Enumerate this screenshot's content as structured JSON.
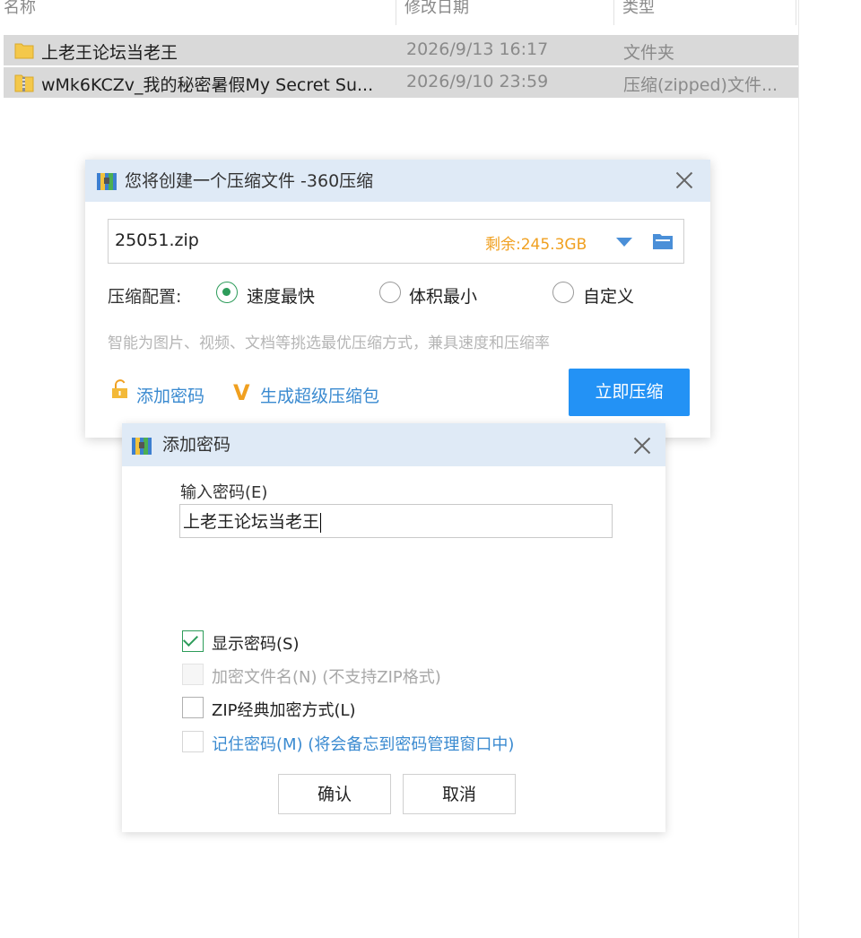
{
  "explorer": {
    "columns": [
      "名称",
      "修改日期",
      "类型"
    ],
    "rows": [
      {
        "name": "上老王论坛当老王",
        "date": "2026/9/13 16:17",
        "type": "文件夹"
      },
      {
        "name": "wMk6KCZv_我的秘密暑假My Secret Su...",
        "date": "2026/9/10 23:59",
        "type": "压缩(zipped)文件..."
      }
    ]
  },
  "compress_dialog": {
    "title": "您将创建一个压缩文件 -360压缩",
    "filename": "25051.zip",
    "remaining": "剩余:245.3GB",
    "config_label": "压缩配置:",
    "options": [
      "速度最快",
      "体积最小",
      "自定义"
    ],
    "selected_option": "速度最快",
    "hint": "智能为图片、视频、文档等挑选最优压缩方式，兼具速度和压缩率",
    "add_password": "添加密码",
    "super_pack": "生成超级压缩包",
    "compress_button": "立即压缩",
    "colors": {
      "accent": "#2392f5",
      "titlebar": "#dfeaf6",
      "orange": "#f0a020",
      "link": "#3a8ad0",
      "green": "#2d9c5a"
    }
  },
  "password_dialog": {
    "title": "添加密码",
    "input_label": "输入密码(E)",
    "password_value": "上老王论坛当老王",
    "checkboxes": [
      {
        "label": "显示密码(S)",
        "checked": true,
        "enabled": true
      },
      {
        "label": "加密文件名(N) (不支持ZIP格式)",
        "checked": false,
        "enabled": false
      },
      {
        "label": "ZIP经典加密方式(L)",
        "checked": false,
        "enabled": true
      },
      {
        "label": "记住密码(M) (将会备忘到密码管理窗口中)",
        "checked": false,
        "enabled": true
      }
    ],
    "ok_button": "确认",
    "cancel_button": "取消"
  }
}
